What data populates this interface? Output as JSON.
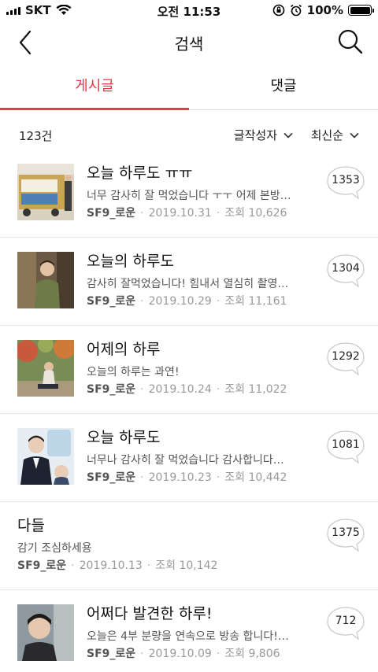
{
  "status_bar": {
    "carrier": "SKT",
    "time": "오전 11:53",
    "battery": "100%"
  },
  "nav": {
    "title": "검색",
    "icons": [
      "back-arrow-icon",
      "search-icon"
    ]
  },
  "tabs": [
    {
      "label": "게시글",
      "active": true
    },
    {
      "label": "댓글",
      "active": false
    }
  ],
  "filter": {
    "count": "123건",
    "author_filter": "글작성자",
    "sort": "최신순"
  },
  "accent_color": "#e8384a",
  "posts": [
    {
      "title": "오늘 하루도 ㅠㅠ",
      "excerpt": "너무 감사히 잘 먹었습니다 ㅜㅜ 어제 본방…",
      "author": "SF9_로운",
      "date": "2019.10.31",
      "views": "조회 10,626",
      "comments": "1353",
      "thumb": "food-truck-photo"
    },
    {
      "title": "오늘의 하루도",
      "excerpt": "감사히 잘먹었습니다! 힘내서 열심히 촬영…",
      "author": "SF9_로운",
      "date": "2019.10.29",
      "views": "조회 11,161",
      "comments": "1304",
      "thumb": "person-photo"
    },
    {
      "title": "어제의 하루",
      "excerpt": "오늘의 하루는 과연!",
      "author": "SF9_로운",
      "date": "2019.10.24",
      "views": "조회 11,022",
      "comments": "1292",
      "thumb": "outdoor-photo"
    },
    {
      "title": "오늘 하루도",
      "excerpt": "너무나 감사히 잘 먹었습니다 감사합니다…",
      "author": "SF9_로운",
      "date": "2019.10.23",
      "views": "조회 10,442",
      "comments": "1081",
      "thumb": "uniform-photo"
    },
    {
      "title": "다들",
      "excerpt": "감기 조심하세용",
      "author": "SF9_로운",
      "date": "2019.10.13",
      "views": "조회 10,142",
      "comments": "1375",
      "thumb": ""
    },
    {
      "title": "어쩌다 발견한 하루!",
      "excerpt": "오늘은 4부 분량을 연속으로 방송 합니다!…",
      "author": "SF9_로운",
      "date": "2019.10.09",
      "views": "조회 9,806",
      "comments": "712",
      "thumb": "portrait-photo"
    }
  ]
}
